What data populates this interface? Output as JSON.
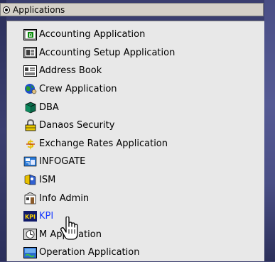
{
  "header": {
    "title": "Applications"
  },
  "items": [
    {
      "label": "Accounting  Application",
      "icon": "accounting-icon"
    },
    {
      "label": "Accounting Setup  Application",
      "icon": "accounting-setup-icon"
    },
    {
      "label": "Address Book",
      "icon": "address-book-icon"
    },
    {
      "label": "Crew Application",
      "icon": "crew-icon"
    },
    {
      "label": "DBA",
      "icon": "database-icon"
    },
    {
      "label": "Danaos Security",
      "icon": "padlock-icon"
    },
    {
      "label": "Exchange Rates Application",
      "icon": "exchange-rates-icon"
    },
    {
      "label": "INFOGATE",
      "icon": "infogate-icon"
    },
    {
      "label": "ISM",
      "icon": "ism-icon"
    },
    {
      "label": "Info Admin",
      "icon": "info-admin-icon"
    },
    {
      "label": "KPI",
      "icon": "kpi-icon",
      "selected": true
    },
    {
      "label": "M     Application",
      "icon": "m-application-icon"
    },
    {
      "label": "Operation  Application",
      "icon": "operation-icon"
    }
  ],
  "colors": {
    "link": "#1a3cff",
    "list_background": "#e8e8e8",
    "header_background": "#d4d0c8"
  },
  "cursor": {
    "icon": "hand-pointer-icon"
  }
}
